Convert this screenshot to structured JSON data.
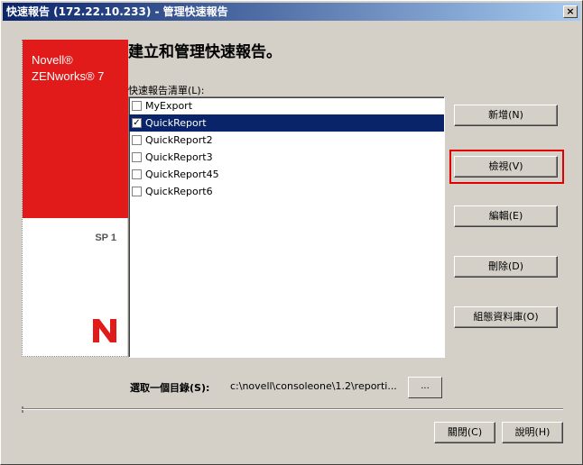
{
  "window": {
    "title": "快速報告 (172.22.10.233) - 管理快速報告",
    "close_label": "×"
  },
  "banner": {
    "brand_line1": "Novell®",
    "brand_line2": "ZENworks® 7",
    "sp_label": "SP 1",
    "brand_color": "#e11a1a"
  },
  "heading": "建立和管理快速報告。",
  "list": {
    "label": "快速報告清單(L):",
    "items": [
      {
        "name": "MyExport",
        "checked": false,
        "selected": false
      },
      {
        "name": "QuickReport",
        "checked": true,
        "selected": true
      },
      {
        "name": "QuickReport2",
        "checked": false,
        "selected": false
      },
      {
        "name": "QuickReport3",
        "checked": false,
        "selected": false
      },
      {
        "name": "QuickReport45",
        "checked": false,
        "selected": false
      },
      {
        "name": "QuickReport6",
        "checked": false,
        "selected": false
      }
    ]
  },
  "buttons": {
    "new": "新增(N)",
    "view": "檢視(V)",
    "edit": "編輯(E)",
    "delete": "刪除(D)",
    "configure_db": "組態資料庫(O)"
  },
  "directory": {
    "label": "選取一個目錄(S):",
    "value": "c:\\novell\\consoleone\\1.2\\reporti...",
    "browse_label": "..."
  },
  "footer": {
    "close": "關閉(C)",
    "help": "說明(H)"
  },
  "highlight_color": "#e00000",
  "selection_color": "#0a246a"
}
